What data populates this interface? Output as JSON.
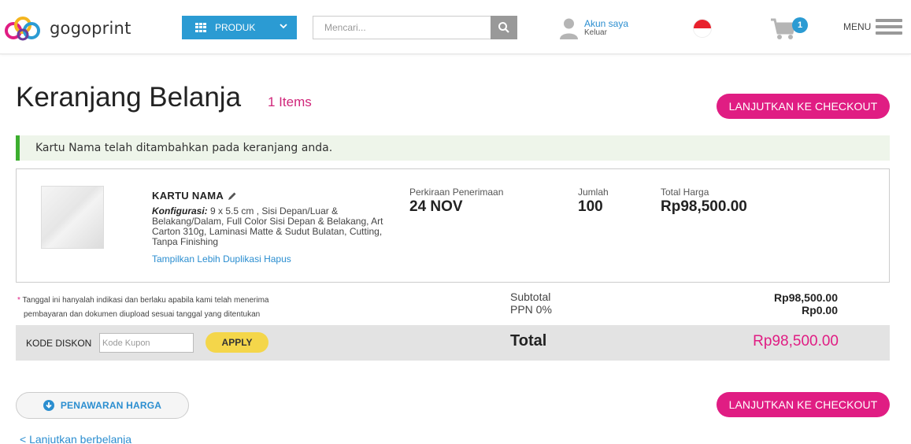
{
  "header": {
    "logo_text": "gogoprint",
    "produk_label": "PRODUK",
    "search_placeholder": "Mencari...",
    "account_label": "Akun saya",
    "logout_label": "Keluar",
    "cart_count": "1",
    "menu_label": "MENU"
  },
  "cart": {
    "title": "Keranjang Belanja",
    "items_count": "1 Items",
    "checkout_label": "LANJUTKAN KE CHECKOUT",
    "alert": "Kartu Nama telah ditambahkan pada keranjang anda."
  },
  "item": {
    "name": "KARTU NAMA",
    "config_label": "Konfigurasi:",
    "config_text": "9 x 5.5 cm , Sisi Depan/Luar & Belakang/Dalam, Full Color Sisi Depan & Belakang, Art Carton 310g, Laminasi Matte & Sudut Bulatan, Cutting, Tanpa Finishing",
    "links": [
      "Tampilkan Lebih",
      "Duplikasi",
      "Hapus"
    ],
    "delivery_label": "Perkiraan Penerimaan",
    "delivery_value": "24 NOV",
    "qty_label": "Jumlah",
    "qty_value": "100",
    "price_label": "Total Harga",
    "price_value": "Rp98,500.00"
  },
  "summary": {
    "note_line1": "Tanggal ini hanyalah indikasi dan berlaku apabila kami telah menerima",
    "note_line2": "pembayaran dan dokumen diupload sesuai tanggal yang ditentukan",
    "subtotal_label": "Subtotal",
    "subtotal_value": "Rp98,500.00",
    "ppn_label": "PPN 0%",
    "ppn_value": "Rp0.00",
    "discount_label": "KODE DISKON",
    "coupon_placeholder": "Kode Kupon",
    "apply_label": "APPLY",
    "total_label": "Total",
    "total_value": "Rp98,500.00"
  },
  "footer": {
    "quote_label": "PENAWARAN HARGA",
    "continue_label": "< Lanjutkan berbelanja"
  },
  "colors": {
    "primary_blue": "#2b9bd3",
    "accent_pink": "#e01d83",
    "apply_yellow": "#f4d64a",
    "alert_green": "#3cae2f"
  }
}
